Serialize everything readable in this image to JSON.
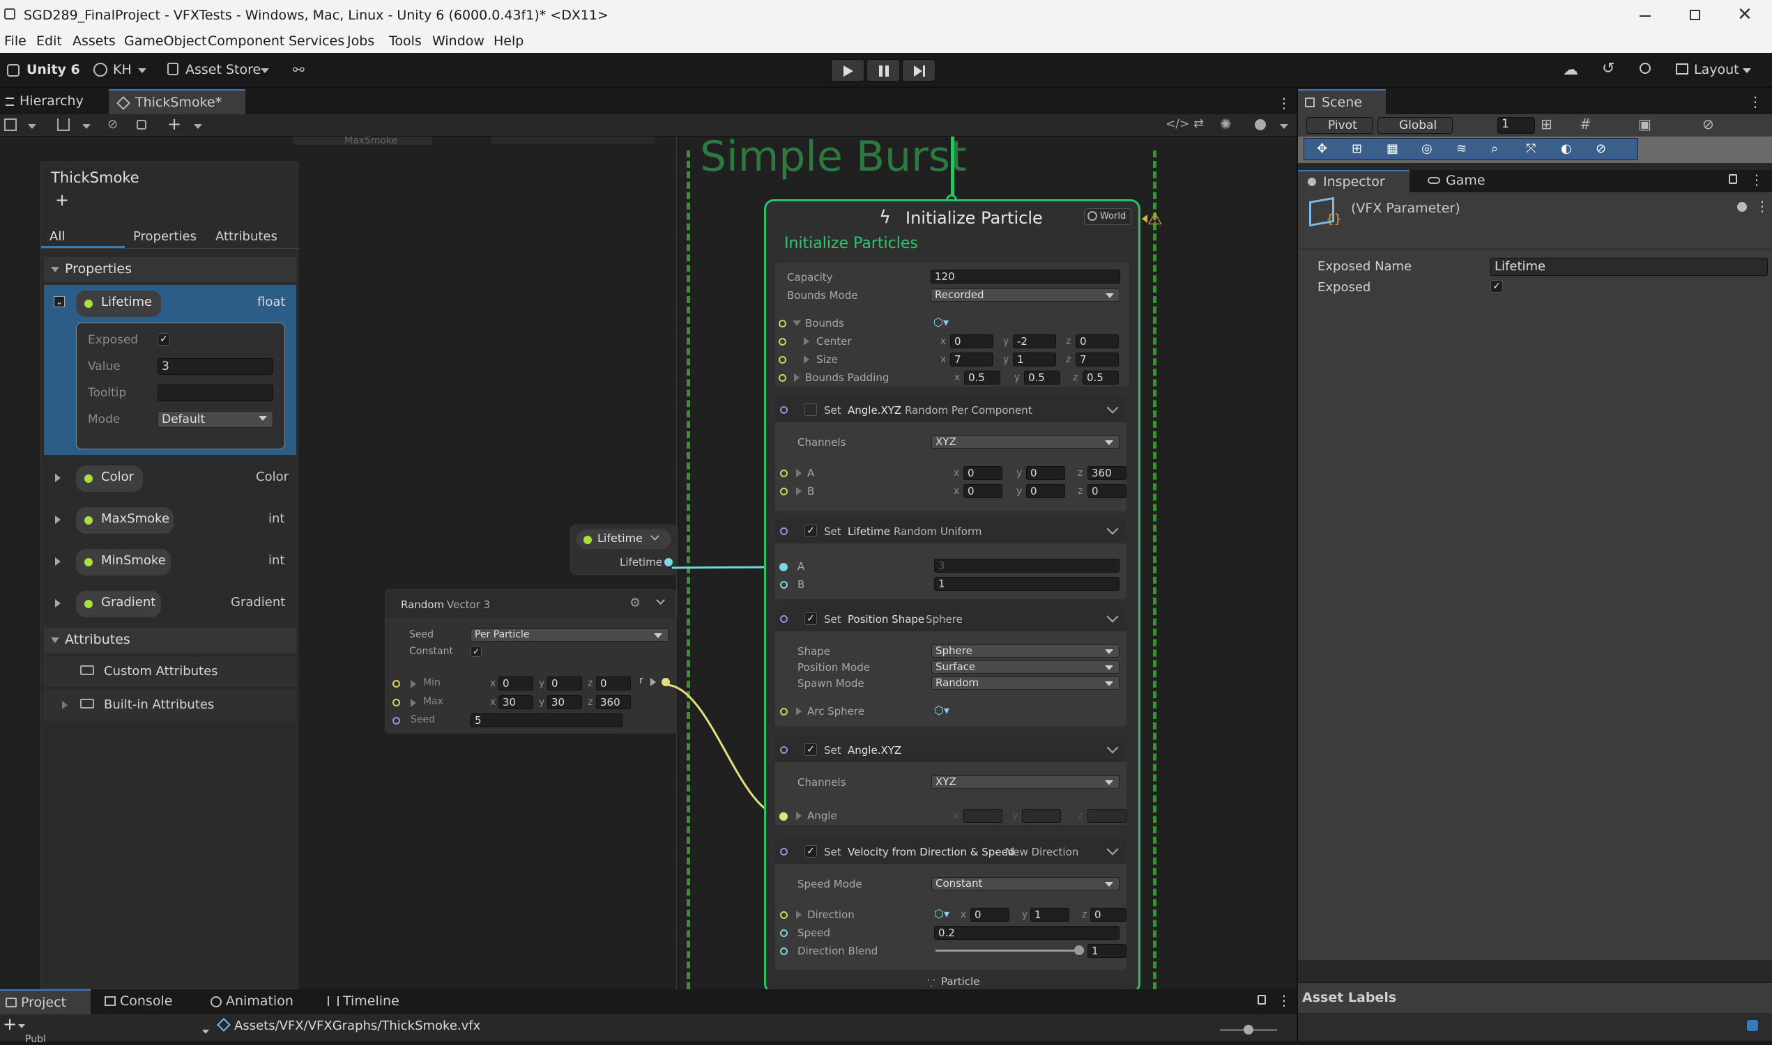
{
  "window": {
    "title": "SGD289_FinalProject - VFXTests - Windows, Mac, Linux - Unity 6 (6000.0.43f1)* <DX11>"
  },
  "menu": [
    "File",
    "Edit",
    "Assets",
    "GameObject",
    "Component",
    "Services",
    "Jobs",
    "Tools",
    "Window",
    "Help"
  ],
  "toolbar": {
    "unity": "Unity 6",
    "account": "KH",
    "asset_store": "Asset Store",
    "layout": "Layout"
  },
  "tabs": {
    "hierarchy": "Hierarchy",
    "graph": "ThickSmoke*",
    "scene": "Scene",
    "inspector": "Inspector",
    "game": "Game",
    "project": "Project",
    "console": "Console",
    "animation": "Animation",
    "timeline": "Timeline"
  },
  "scene_toolbar": {
    "pivot": "Pivot",
    "global": "Global",
    "grid_value": "1"
  },
  "blackboard": {
    "title": "ThickSmoke",
    "add": "+",
    "tabs": [
      "All",
      "Properties",
      "Attributes"
    ],
    "properties_header": "Properties",
    "lifetime": {
      "name": "Lifetime",
      "type": "float",
      "exposed_label": "Exposed",
      "exposed": "✓",
      "value_label": "Value",
      "value": "3",
      "tooltip_label": "Tooltip",
      "tooltip": "",
      "mode_label": "Mode",
      "mode": "Default"
    },
    "props": [
      {
        "name": "Color",
        "type": "Color"
      },
      {
        "name": "MaxSmoke",
        "type": "int"
      },
      {
        "name": "MinSmoke",
        "type": "int"
      },
      {
        "name": "Gradient",
        "type": "Gradient"
      }
    ],
    "attributes_header": "Attributes",
    "custom": "Custom Attributes",
    "builtin": "Built-in Attributes"
  },
  "graph": {
    "faded": "MaxSmoke",
    "system_title": "Simple Burst",
    "lifetime_node": {
      "title": "Lifetime",
      "output": "Lifetime"
    },
    "random": {
      "title": "Random",
      "subtitle": "Vector 3",
      "seed_label": "Seed",
      "seed_mode": "Per Particle",
      "constant_label": "Constant",
      "constant": "✓",
      "min_label": "Min",
      "max_label": "Max",
      "min": [
        "0",
        "0",
        "0"
      ],
      "max": [
        "30",
        "30",
        "360"
      ],
      "seed_value_label": "Seed",
      "seed": "5",
      "out": "r"
    },
    "init": {
      "title": "Initialize Particle",
      "space": "World",
      "subtitle": "Initialize Particles",
      "capacity_label": "Capacity",
      "capacity": "120",
      "bounds_mode_label": "Bounds Mode",
      "bounds_mode": "Recorded",
      "bounds_label": "Bounds",
      "center_label": "Center",
      "center": [
        "0",
        "-2",
        "0"
      ],
      "size_label": "Size",
      "size": [
        "7",
        "1",
        "7"
      ],
      "padding_label": "Bounds Padding",
      "padding": [
        "0.5",
        "0.5",
        "0.5"
      ],
      "set_label": "Set",
      "b1": {
        "name": "Angle.XYZ",
        "mode": "Random Per Component",
        "channels_label": "Channels",
        "channels": "XYZ",
        "a_label": "A",
        "a": [
          "0",
          "0",
          "360"
        ],
        "b_label": "B",
        "b": [
          "0",
          "0",
          "0"
        ]
      },
      "b2": {
        "name": "Lifetime",
        "mode": "Random Uniform",
        "a_label": "A",
        "a": "3",
        "b_label": "B",
        "b": "1"
      },
      "b3": {
        "name": "Position Shape",
        "mode": "Sphere",
        "shape_label": "Shape",
        "shape": "Sphere",
        "pos_label": "Position Mode",
        "pos": "Surface",
        "spawn_label": "Spawn Mode",
        "spawn": "Random",
        "arc_label": "Arc Sphere"
      },
      "b4": {
        "name": "Angle.XYZ",
        "channels_label": "Channels",
        "channels": "XYZ",
        "angle_label": "Angle"
      },
      "b5": {
        "name": "Velocity from Direction & Speed",
        "mode": "New Direction",
        "speed_mode_label": "Speed Mode",
        "speed_mode": "Constant",
        "dir_label": "Direction",
        "dir": [
          "0",
          "1",
          "0"
        ],
        "speed_label": "Speed",
        "speed": "0.2",
        "blend_label": "Direction Blend",
        "blend": "1",
        "blend_fill": 1.0
      },
      "footer": "Particle"
    },
    "axes": [
      "x",
      "y",
      "z"
    ]
  },
  "inspector": {
    "object": "(VFX Parameter)",
    "exposed_name_label": "Exposed Name",
    "exposed_name": "Lifetime",
    "exposed_label": "Exposed",
    "exposed": "✓",
    "asset_labels": "Asset Labels"
  },
  "project": {
    "path": "Assets/VFX/VFXGraphs/ThickSmoke.vfx",
    "truncated": "Publ"
  },
  "colors": {
    "accent": "#3a79bb",
    "selection": "#2c5d87",
    "context_border": "#27c46a",
    "system_dash": "#3f8f37",
    "link_cyan": "#6fd6e4",
    "link_yellow": "#e6e07a"
  }
}
